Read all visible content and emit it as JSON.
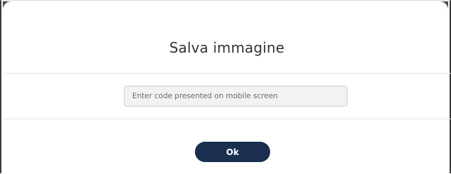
{
  "dialog": {
    "title": "Salva immagine",
    "code_input": {
      "value": "",
      "placeholder": "Enter code presented on mobile screen"
    },
    "ok_label": "Ok"
  },
  "colors": {
    "ok_button_bg": "#1a2e4f",
    "ok_button_text": "#ffffff",
    "input_bg": "#f2f2f2",
    "divider": "#e6e6e6",
    "frame_border": "#3a3a3a"
  }
}
